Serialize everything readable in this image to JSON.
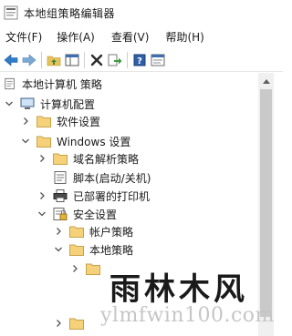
{
  "window": {
    "title": "本地组策略编辑器"
  },
  "menu": [
    "文件(F)",
    "操作(A)",
    "查看(V)",
    "帮助(H)"
  ],
  "toolbar": {
    "buttons": [
      "back-icon",
      "forward-icon",
      "up-folder-icon",
      "show-hide-tree-icon",
      "delete-icon",
      "export-icon",
      "help-icon",
      "properties-icon"
    ]
  },
  "tree": {
    "items": [
      {
        "label": "本地计算机 策略",
        "icon": "policy-doc-icon",
        "chevron": ""
      },
      {
        "label": "计算机配置",
        "icon": "computer-icon",
        "chevron": "expanded"
      },
      {
        "label": "软件设置",
        "icon": "folder-icon",
        "chevron": "collapsed"
      },
      {
        "label": "Windows 设置",
        "icon": "folder-icon",
        "chevron": "expanded"
      },
      {
        "label": "域名解析策略",
        "icon": "folder-icon",
        "chevron": "collapsed"
      },
      {
        "label": "脚本(启动/关机)",
        "icon": "script-icon",
        "chevron": ""
      },
      {
        "label": "已部署的打印机",
        "icon": "printer-icon",
        "chevron": "collapsed"
      },
      {
        "label": "安全设置",
        "icon": "security-icon",
        "chevron": "expanded"
      },
      {
        "label": "帐户策略",
        "icon": "folder-icon",
        "chevron": "collapsed"
      },
      {
        "label": "本地策略",
        "icon": "folder-icon",
        "chevron": "expanded"
      }
    ]
  },
  "watermark": {
    "title": "雨林木风",
    "url": "ylmfwin100.com"
  }
}
